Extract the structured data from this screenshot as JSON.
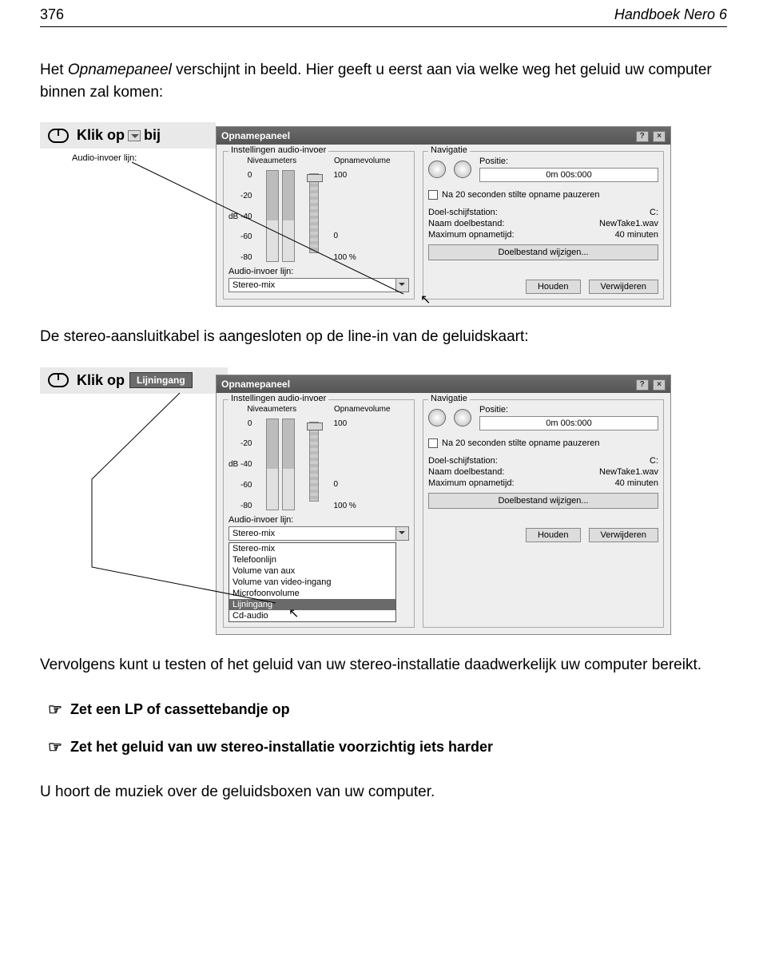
{
  "header": {
    "page_number": "376",
    "book_title": "Handboek Nero 6"
  },
  "para1": {
    "pre": "Het ",
    "em": "Opnamepaneel",
    "post": " verschijnt in beeld. Hier geeft u eerst aan via welke weg het geluid uw computer binnen zal komen:"
  },
  "instr1": {
    "label": "Klik op",
    "suffix": "bij",
    "sub_label": "Audio-invoer lijn:"
  },
  "instr2": {
    "label": "Klik op",
    "chip": "Lijningang"
  },
  "panel": {
    "title": "Opnamepaneel",
    "audio_group": "Instellingen audio-invoer",
    "niveaumeters": "Niveaumeters",
    "opnamevolume": "Opnamevolume",
    "db": [
      "0",
      "-20",
      "-40",
      "-60",
      "-80"
    ],
    "db_prefix": "dB",
    "vol_top": "100",
    "vol_bot": "0",
    "vol_pct": "100 %",
    "ai_label": "Audio-invoer lijn:",
    "ai_value": "Stereo-mix",
    "nav_group": "Navigatie",
    "pos_label": "Positie:",
    "pos_value": "0m 00s:000",
    "chk_label": "Na 20 seconden stilte opname pauzeren",
    "kv": [
      [
        "Doel-schijfstation:",
        "C:"
      ],
      [
        "Naam doelbestand:",
        "NewTake1.wav"
      ],
      [
        "Maximum opnametijd:",
        "40 minuten"
      ]
    ],
    "target_btn": "Doelbestand wijzigen...",
    "hold": "Houden",
    "remove": "Verwijderen"
  },
  "combo": [
    "Stereo-mix",
    "Telefoonlijn",
    "Volume van aux",
    "Volume van video-ingang",
    "Microfoonvolume",
    "Lijningang",
    "Cd-audio"
  ],
  "para2": "De stereo-aansluitkabel is aangesloten op de line-in van de geluidskaart:",
  "para3": "Vervolgens kunt u testen of het geluid van uw stereo-installatie daadwerkelijk uw computer bereikt.",
  "hand1": "Zet een LP of cassettebandje op",
  "hand2": "Zet het geluid van uw stereo-installatie voorzichtig iets harder",
  "para4": "U hoort de muziek over de geluidsboxen van uw computer."
}
